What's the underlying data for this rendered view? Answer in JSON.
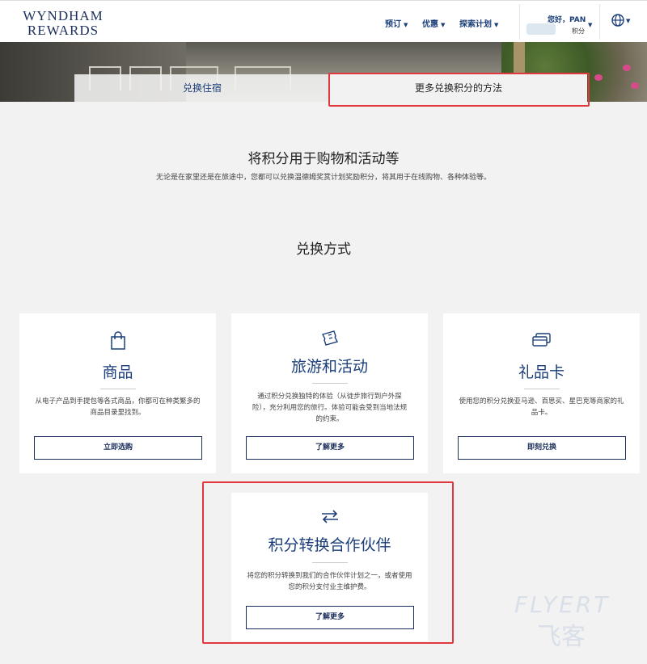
{
  "header": {
    "logo_line1": "WYNDHAM",
    "logo_line2": "REWARDS",
    "nav": [
      "预订",
      "优惠",
      "探索计划"
    ],
    "account_greeting": "您好，PAN",
    "account_points_label": "积分"
  },
  "tabs": {
    "left": "兑换住宿",
    "right": "更多兑换积分的方法"
  },
  "intro": {
    "title": "将积分用于购物和活动等",
    "subtitle": "无论是在家里还是在旅途中，您都可以兑换温德姆奖赏计划奖励积分，将其用于在线购物、各种体验等。"
  },
  "section_title": "兑换方式",
  "cards": [
    {
      "icon": "shopping-bag-icon",
      "title": "商品",
      "desc": "从电子产品到手提包等各式商品，你都可在种类繁多的商品目录里找到。",
      "button": "立即选购"
    },
    {
      "icon": "ticket-icon",
      "title": "旅游和活动",
      "desc": "通过积分兑换独特的体验（从徒步旅行到户外探险），充分利用您的旅行。体验可能会受到当地法规的约束。",
      "button": "了解更多"
    },
    {
      "icon": "gift-card-icon",
      "title": "礼品卡",
      "desc": "使用您的积分兑换亚马逊、百思买、星巴克等商家的礼品卡。",
      "button": "即刻兑换"
    },
    {
      "icon": "transfer-arrows-icon",
      "title": "积分转换合作伙伴",
      "desc": "将您的积分转换到我们的合作伙伴计划之一，或者使用您的积分支付业主维护费。",
      "button": "了解更多"
    }
  ],
  "watermark": {
    "line1": "FLYERT",
    "line2": "飞客"
  },
  "colors": {
    "brand": "#1b2d5a",
    "link": "#1b3e7a",
    "highlight": "#e0383e"
  }
}
